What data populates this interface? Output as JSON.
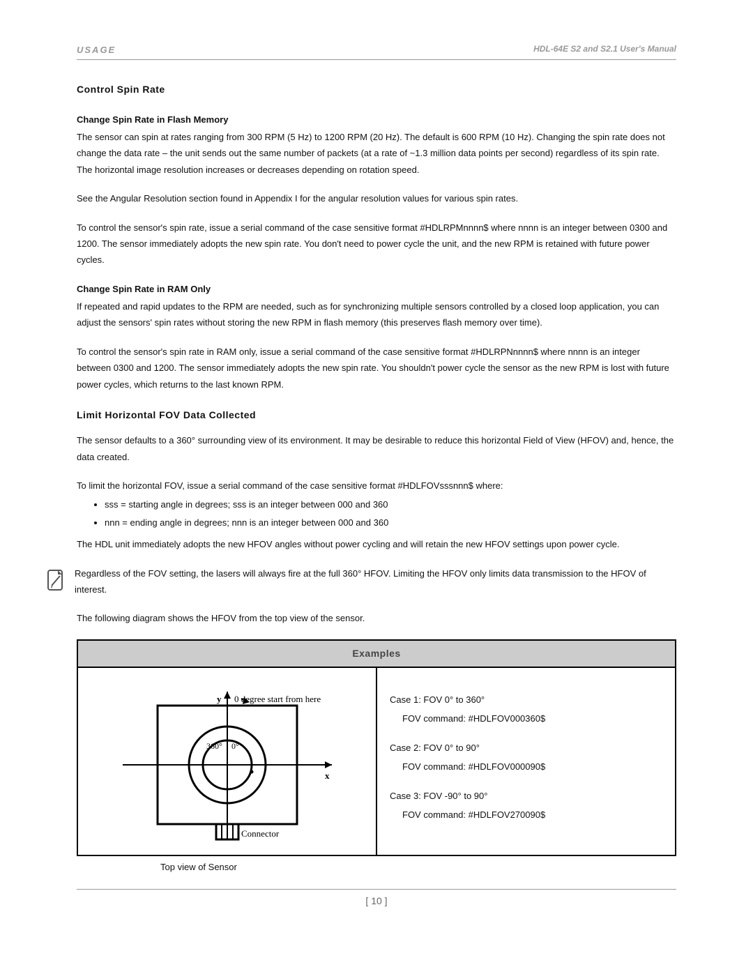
{
  "header": {
    "section_label": "USAGE",
    "manual_title": "HDL-64E S2 and S2.1 User's Manual"
  },
  "s1": {
    "heading": "Control Spin Rate",
    "sub1_heading": "Change Spin Rate in Flash Memory",
    "sub1_p1": "The sensor can spin at rates ranging from 300 RPM (5 Hz) to 1200 RPM (20 Hz). The default is 600 RPM (10 Hz). Changing the spin rate does not change the data rate – the unit sends out the same number of packets (at a rate of ~1.3 million data points per second) regardless of its spin rate. The horizontal image resolution increases or decreases depending on rotation speed.",
    "sub1_p2": "See the Angular Resolution section found in Appendix I for the angular resolution values for various spin rates.",
    "sub1_p3": "To control the sensor's spin rate, issue a serial command of the case sensitive format #HDLRPMnnnn$ where nnnn is an integer between 0300 and 1200. The sensor immediately adopts the new spin rate. You don't need to power cycle the unit, and the new RPM is retained with future power cycles.",
    "sub2_heading": "Change Spin Rate in RAM Only",
    "sub2_p1": "If repeated and rapid updates to the RPM are needed, such as for synchronizing multiple sensors controlled by a closed loop application, you can adjust the sensors' spin rates without storing the new RPM in flash memory (this preserves flash memory over time).",
    "sub2_p2": "To control the sensor's spin rate in RAM only, issue a serial command of the case sensitive format #HDLRPNnnnn$ where nnnn is an integer between 0300 and 1200. The sensor immediately adopts the new spin rate. You shouldn't power cycle the sensor as the new RPM is lost with future power cycles, which returns to the last known RPM."
  },
  "s2": {
    "heading": "Limit Horizontal FOV Data Collected",
    "p1": "The sensor defaults to a 360° surrounding view of its environment. It may be desirable to reduce this horizontal Field of View (HFOV) and, hence, the data created.",
    "p2": "To limit the horizontal FOV, issue a serial command of the case sensitive format #HDLFOVsssnnn$ where:",
    "bullets": [
      "sss = starting angle in degrees; sss is an integer between 000 and 360",
      "nnn = ending angle in degrees; nnn is an integer between 000 and 360"
    ],
    "p3": "The HDL unit immediately adopts the new HFOV angles without power cycling and will retain the new HFOV settings upon power cycle.",
    "note": "Regardless of the FOV setting, the lasers will always fire at the full 360° HFOV.  Limiting the HFOV only limits data transmission to the HFOV of interest.",
    "p4": "The following diagram shows the HFOV from the top view of the sensor."
  },
  "examples": {
    "table_head": "Examples",
    "diagram": {
      "y_label": "y",
      "start_label": "0 degree start from here",
      "l360": "360°",
      "l0": "0°",
      "x_label": "x",
      "connector": "Connector"
    },
    "caption": "Top view of Sensor",
    "cases": {
      "c1_a": "Case 1: FOV 0° to 360°",
      "c1_b": "FOV command: #HDLFOV000360$",
      "c2_a": "Case 2: FOV 0° to 90°",
      "c2_b": "FOV command: #HDLFOV000090$",
      "c3_a": "Case 3: FOV -90° to 90°",
      "c3_b": "FOV command: #HDLFOV270090$"
    }
  },
  "footer": {
    "page_num": "[ 10 ]"
  }
}
